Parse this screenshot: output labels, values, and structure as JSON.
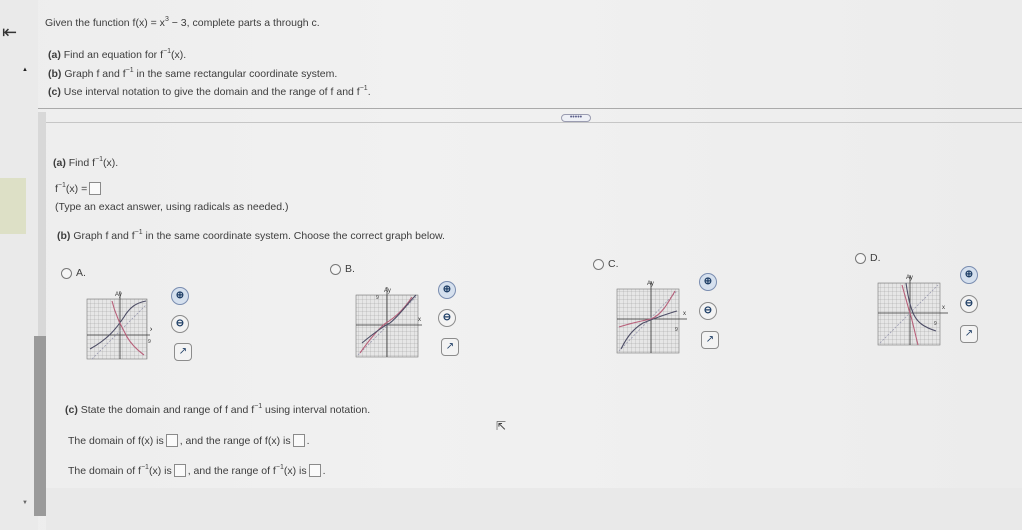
{
  "nav": {
    "back_icon": "arrow-left-icon"
  },
  "problem": {
    "intro_pre": "Given the function f(x) = x",
    "intro_exp": "3",
    "intro_post": " − 3, complete parts a through c.",
    "part_a_letter": "(a)",
    "part_a_pre": " Find an equation for f",
    "part_a_post": "(x).",
    "part_b_letter": "(b)",
    "part_b_pre": " Graph f and f",
    "part_b_post": " in the same rectangular coordinate system.",
    "part_c_letter": "(c)",
    "part_c_pre": " Use interval notation to give the domain and the range of f and f",
    "part_c_post": ".",
    "inverse_exp": "−1"
  },
  "divider_pill": "•••••",
  "part_a": {
    "letter": "(a)",
    "prompt_pre": " Find f",
    "prompt_post": "(x).",
    "answer_pre": "f",
    "answer_post": "(x) =",
    "hint": "(Type an exact answer, using radicals as needed.)"
  },
  "part_b": {
    "letter": "(b)",
    "prompt_pre": " Graph f and f",
    "prompt_post": " in the same coordinate system. Choose the correct graph below.",
    "options": [
      {
        "label": "A.",
        "y_label": "Ay",
        "x_label": "x",
        "tick_label": "9"
      },
      {
        "label": "B.",
        "y_label": "Ay",
        "x_label": "x",
        "tick_label": "9"
      },
      {
        "label": "C.",
        "y_label": "Ay",
        "x_label": "x",
        "tick_label": "9"
      },
      {
        "label": "D.",
        "y_label": "Ay",
        "x_label": "x",
        "tick_label": "9"
      }
    ]
  },
  "part_c": {
    "letter": "(c)",
    "prompt_pre": " State the domain and range of f and f",
    "prompt_post": " using interval notation.",
    "line1_a": "The domain of f(x) is",
    "line1_b": ", and the range of f(x) is",
    "line1_c": ".",
    "line2_a": "The domain of f",
    "line2_b": "(x) is",
    "line2_c": ", and the range of f",
    "line2_d": "(x) is",
    "line2_e": "."
  },
  "icons": {
    "zoom_in": "⊕",
    "zoom_out": "⊖",
    "external": "↗"
  },
  "colors": {
    "inverse_curve": "#b8607a",
    "function_curve": "#4e4e66",
    "mirror_line": "#9a9ab0"
  }
}
